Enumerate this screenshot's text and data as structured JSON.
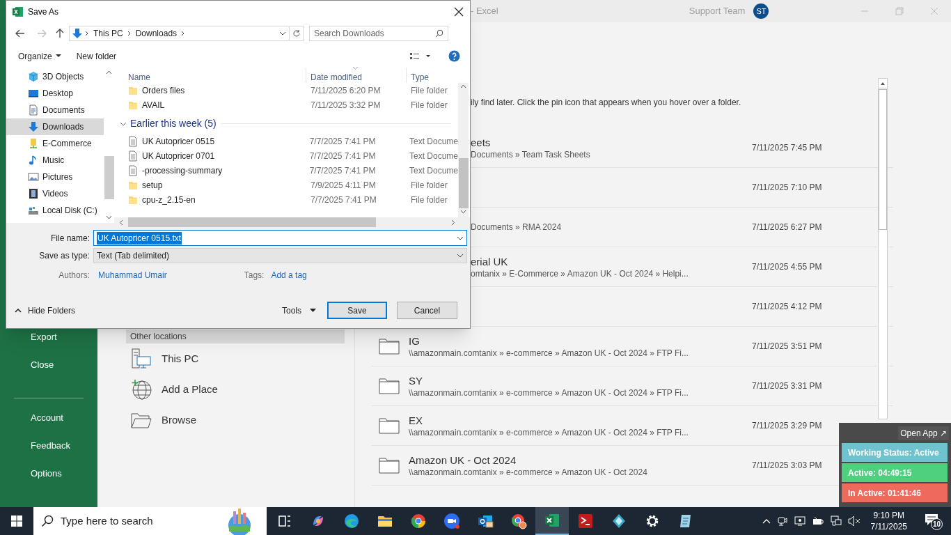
{
  "excel": {
    "title": "- Excel",
    "account": "Support Team",
    "initials": "ST",
    "sidebar_top": [
      {
        "label": "Export"
      },
      {
        "label": "Close"
      }
    ],
    "sidebar_bottom": [
      {
        "label": "Account"
      },
      {
        "label": "Feedback"
      },
      {
        "label": "Options"
      }
    ],
    "places": {
      "header": "Other locations",
      "items": [
        {
          "label": "This PC",
          "kind": "pc"
        },
        {
          "label": "Add a Place",
          "kind": "globe"
        },
        {
          "label": "Browse",
          "kind": "browse"
        }
      ]
    },
    "hint": "ily find later. Click the pin icon that appears when you hover over a folder.",
    "recent_partial": [
      {
        "title": "eets",
        "path": "Documents » Team Task Sheets",
        "date": "7/11/2025 7:45 PM"
      },
      {
        "date": "7/11/2025 7:10 PM"
      },
      {
        "path": "Documents » RMA 2024",
        "date": "7/11/2025 6:27 PM"
      },
      {
        "title": "erial UK",
        "path": "omtanix » E-Commerce » Amazon UK - Oct 2024 » Helpi...",
        "date": "7/11/2025 4:55 PM"
      },
      {
        "date": "7/11/2025 4:12 PM"
      }
    ],
    "recent": [
      {
        "title": "IG",
        "path": "\\\\amazonmain.comtanix » e-commerce » Amazon UK - Oct 2024 » FTP Fi...",
        "date": "7/11/2025 3:51 PM"
      },
      {
        "title": "SY",
        "path": "\\\\amazonmain.comtanix » e-commerce » Amazon UK - Oct 2024 » FTP Fi...",
        "date": "7/11/2025 3:31 PM"
      },
      {
        "title": "EX",
        "path": "\\\\amazonmain.comtanix » e-commerce » Amazon UK - Oct 2024 » FTP Fi...",
        "date": "7/11/2025 3:29 PM"
      },
      {
        "title": "Amazon UK - Oct 2024",
        "path": "\\\\amazonmain.comtanix » e-commerce » Amazon UK - Oct 2024",
        "date": "7/11/2025 3:03 PM"
      }
    ]
  },
  "dialog": {
    "title": "Save As",
    "path": [
      "This PC",
      "Downloads"
    ],
    "search_placeholder": "Search Downloads",
    "organize": "Organize",
    "new_folder": "New folder",
    "nav": [
      {
        "label": "3D Objects",
        "kind": "cube",
        "selected": false
      },
      {
        "label": "Desktop",
        "kind": "desktop",
        "selected": false
      },
      {
        "label": "Documents",
        "kind": "documents",
        "selected": false
      },
      {
        "label": "Downloads",
        "kind": "downloads",
        "selected": true
      },
      {
        "label": "E-Commerce",
        "kind": "netdrive",
        "selected": false
      },
      {
        "label": "Music",
        "kind": "music",
        "selected": false
      },
      {
        "label": "Pictures",
        "kind": "pictures",
        "selected": false
      },
      {
        "label": "Videos",
        "kind": "videos",
        "selected": false
      },
      {
        "label": "Local Disk (C:)",
        "kind": "disk",
        "selected": false
      }
    ],
    "columns": [
      "Name",
      "Date modified",
      "Type"
    ],
    "files": [
      {
        "name": "Orders files",
        "date": "7/11/2025 6:20 PM",
        "type": "File folder",
        "kind": "folder"
      },
      {
        "name": "AVAIL",
        "date": "7/11/2025 3:32 PM",
        "type": "File folder",
        "kind": "folder"
      }
    ],
    "group": {
      "label": "Earlier this week (5)",
      "expanded": true,
      "files": [
        {
          "name": "UK Autopricer 0515",
          "date": "7/7/2025 7:41 PM",
          "type": "Text Docume",
          "kind": "text"
        },
        {
          "name": "UK Autopricer 0701",
          "date": "7/7/2025 7:41 PM",
          "type": "Text Docume",
          "kind": "text"
        },
        {
          "name": "-processing-summary",
          "date": "7/7/2025 7:41 PM",
          "type": "Text Docume",
          "kind": "text"
        },
        {
          "name": "setup",
          "date": "7/9/2025 4:11 PM",
          "type": "File folder",
          "kind": "folder"
        },
        {
          "name": "cpu-z_2.15-en",
          "date": "7/7/2025 7:41 PM",
          "type": "File folder",
          "kind": "folder"
        }
      ]
    },
    "file_name_label": "File name:",
    "file_name": "UK Autopricer 0515.txt",
    "type_label": "Save as type:",
    "save_type": "Text (Tab delimited)",
    "authors_label": "Authors:",
    "author": "Muhammad Umair",
    "tags_label": "Tags:",
    "tags_placeholder": "Add a tag",
    "hide_folders": "Hide Folders",
    "tools": "Tools",
    "save": "Save",
    "cancel": "Cancel"
  },
  "status_widget": {
    "open_app": "Open App ↗",
    "bars": [
      {
        "label": "Working Status: Active",
        "color": "#6ec3cf"
      },
      {
        "label": "Active: 04:49:15",
        "color": "#4fd07f"
      },
      {
        "label": "In Active: 01:41:46",
        "color": "#ee6a5c"
      }
    ]
  },
  "taskbar": {
    "search_placeholder": "Type here to search",
    "apps": [
      {
        "kind": "taskview",
        "selected": false
      },
      {
        "kind": "copilot",
        "selected": false
      },
      {
        "kind": "edge",
        "selected": false
      },
      {
        "kind": "explorer",
        "selected": false
      },
      {
        "kind": "chrome",
        "selected": false
      },
      {
        "kind": "zoom",
        "selected": false
      },
      {
        "kind": "outlook",
        "selected": false
      },
      {
        "kind": "chromeprofile",
        "selected": false
      },
      {
        "kind": "excel",
        "selected": true
      },
      {
        "kind": "filezilla",
        "selected": false
      },
      {
        "kind": "diamond",
        "selected": false
      },
      {
        "kind": "settings",
        "selected": false
      },
      {
        "kind": "notepad",
        "selected": false
      }
    ],
    "time": "9:10 PM",
    "date": "7/11/2025",
    "notifications": "10"
  }
}
